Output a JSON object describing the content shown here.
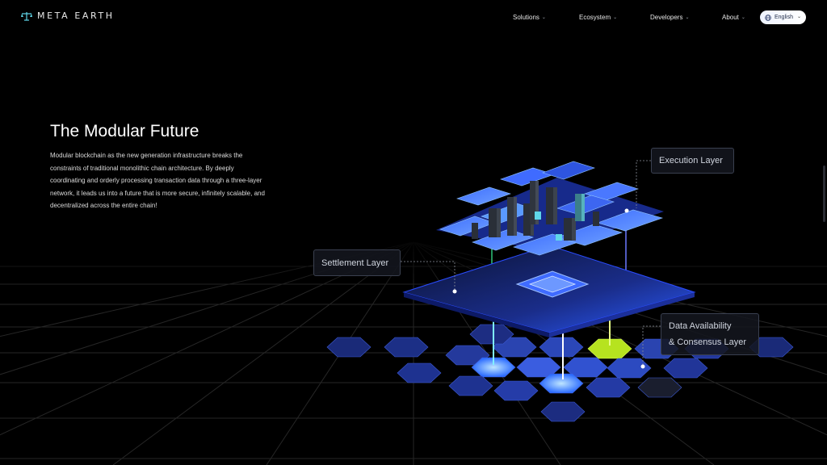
{
  "brand": {
    "name": "META EARTH"
  },
  "nav": [
    {
      "label": "Solutions"
    },
    {
      "label": "Ecosystem"
    },
    {
      "label": "Developers"
    },
    {
      "label": "About"
    }
  ],
  "language": {
    "label": "English"
  },
  "hero": {
    "title": "The Modular Future",
    "description": "Modular blockchain as the new generation infrastructure breaks the constraints of traditional monolithic chain architecture. By deeply coordinating and orderly processing transaction data through a three-layer network, it leads us into a future that is more secure, infinitely scalable, and decentralized across the entire chain!"
  },
  "diagram": {
    "execution_label": "Execution Layer",
    "settlement_label": "Settlement Layer",
    "da_label_line1": "Data Availability",
    "da_label_line2": "& Consensus Layer"
  },
  "colors": {
    "background": "#000000",
    "accent_blue": "#3a7bff",
    "accent_cyan": "#5fd6e8",
    "accent_lime": "#c8f02a",
    "grid": "#2a2a2a"
  }
}
